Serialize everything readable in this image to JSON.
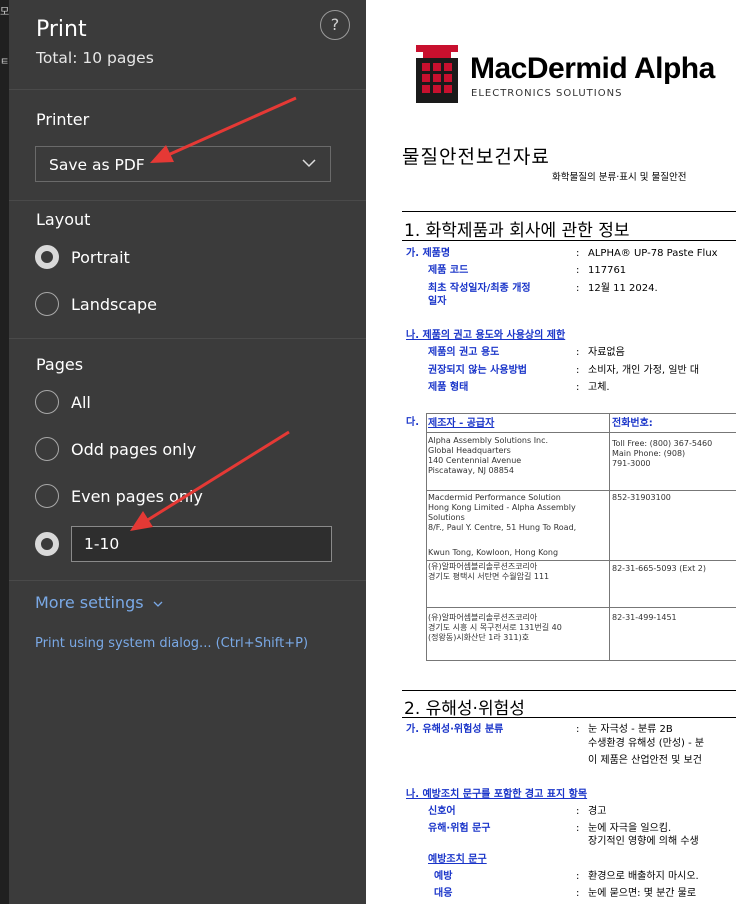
{
  "panel": {
    "title": "Print",
    "total": "Total: 10 pages",
    "help": "?",
    "printer_label": "Printer",
    "printer_value": "Save as PDF",
    "layout_label": "Layout",
    "layout_options": [
      "Portrait",
      "Landscape"
    ],
    "pages_label": "Pages",
    "pages_options": [
      "All",
      "Odd pages only",
      "Even pages only"
    ],
    "pages_range": "1-10",
    "more_settings": "More settings",
    "system_dialog": "Print using system dialog... (Ctrl+Shift+P)"
  },
  "preview": {
    "brand": "MacDermid Alpha",
    "brand_sub": "ELECTRONICS SOLUTIONS",
    "doc_title": "물질안전보건자료",
    "doc_subtitle": "화학물질의 분류·표시 및 물질안전",
    "s1_title": "1. 화학제품과 회사에 관한 정보",
    "s1_a_label": "가. 제품명",
    "s1_a_value": "ALPHA® UP-78 Paste Flux",
    "s1_code_label": "제품 코드",
    "s1_code_value": "117761",
    "s1_date_label1": "최초 작성일자/최종 개정",
    "s1_date_label2": "일자",
    "s1_date_value": "12월 11 2024.",
    "s1_b_label": "나. 제품의 권고 용도와 사용상의 제한",
    "s1_use_label": "제품의 권고 용도",
    "s1_use_value": "자료없음",
    "s1_nonuse_label": "권장되지 않는 사용방법",
    "s1_nonuse_value": "소비자, 개인 가정, 일반 대",
    "s1_form_label": "제품 형태",
    "s1_form_value": "고체.",
    "s1_c_prefix": "다.",
    "table_head1": "제조자 - 공급자",
    "table_head2": "전화번호:",
    "row1_a": [
      "Alpha Assembly Solutions Inc.",
      "Global Headquarters",
      "140 Centennial Avenue",
      "Piscataway, NJ 08854"
    ],
    "row1_b": [
      "Toll Free: (800) 367-5460",
      "Main Phone: (908)",
      "791-3000"
    ],
    "row2_a": [
      "Macdermid Performance Solution",
      "Hong Kong Limited - Alpha Assembly",
      "Solutions",
      "8/F., Paul Y. Centre, 51 Hung To Road,",
      "",
      "Kwun Tong, Kowloon, Hong Kong"
    ],
    "row2_b": [
      "852-31903100"
    ],
    "row3_a": [
      "(유)알파어셈블리솔루션즈코리아",
      "경기도 평택시 서탄면 수월암길 111"
    ],
    "row3_b": [
      "82-31-665-5093 (Ext 2)"
    ],
    "row4_a": [
      "(유)알파어셈블리솔루션즈코리아",
      "경기도 시흥 시 목구전서로 131번길 40",
      "(정왕동)시화산단 1라 311)호"
    ],
    "row4_b": [
      "82-31-499-1451"
    ],
    "s2_title": "2. 유해성·위험성",
    "s2_a_label": "가. 유해성·위험성 분류",
    "s2_a_value1": "눈 자극성 - 분류 2B",
    "s2_a_value2": "수생환경 유해성 (만성) - 분",
    "s2_a_value3": "이 제품은 산업안전 및 보건",
    "s2_b_label": "나. 예방조치 문구를 포함한 경고 표지 항목",
    "s2_signal_label": "신호어",
    "s2_signal_value": "경고",
    "s2_hazard_label": "유해·위험 문구",
    "s2_hazard_value1": "눈에 자극을 일으킴.",
    "s2_hazard_value2": "장기적인 영향에 의해 수생",
    "s2_prec_label": "예방조치 문구",
    "s2_prevent_label": "예방",
    "s2_prevent_value": "환경으로 배출하지 마시오.",
    "s2_response_label": "대응",
    "s2_response_value": "눈에 묻으면: 몇 분간 물로",
    "colon": ":"
  },
  "left_edge": [
    "모",
    "ㅌ"
  ],
  "colors": {
    "panel_bg": "#3b3b3b",
    "link": "#7aa9e6",
    "arrow": "#e53935",
    "doc_blue": "#1a35c9",
    "logo_red": "#c8102e"
  }
}
